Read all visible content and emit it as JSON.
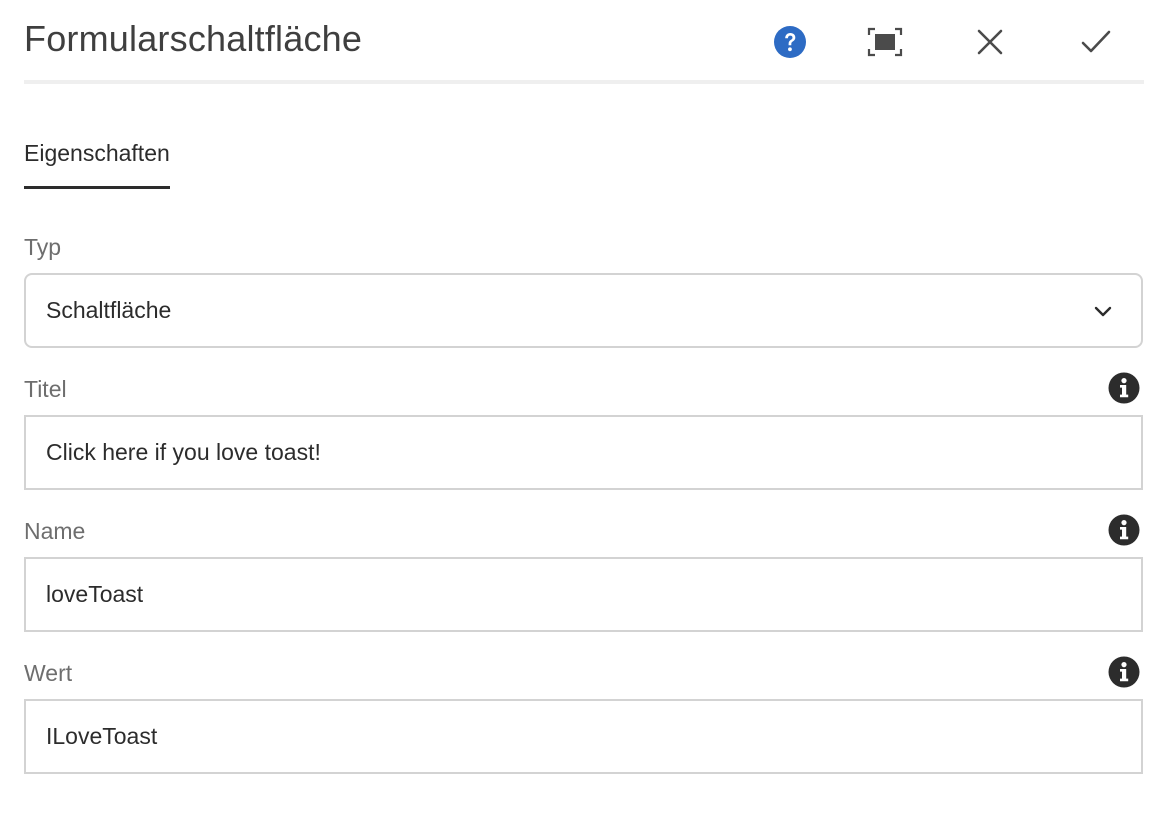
{
  "dialog": {
    "title": "Formularschaltfläche",
    "icons": {
      "help": "help-icon",
      "fullscreen": "fullscreen-icon",
      "close": "close-icon",
      "done": "checkmark-icon"
    },
    "help_color": "#2d6bc4"
  },
  "tabs": [
    {
      "label": "Eigenschaften",
      "active": true
    }
  ],
  "fields": {
    "type": {
      "label": "Typ",
      "value": "Schaltfläche"
    },
    "title": {
      "label": "Titel",
      "value": "Click here if you love toast!"
    },
    "name": {
      "label": "Name",
      "value": "loveToast"
    },
    "value": {
      "label": "Wert",
      "value": "ILoveToast"
    }
  }
}
